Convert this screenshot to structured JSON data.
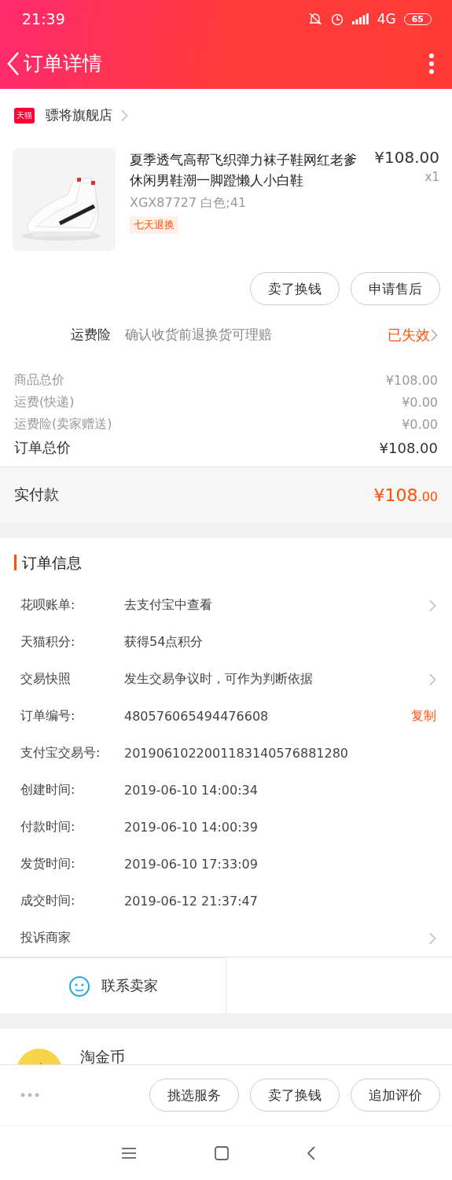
{
  "status_bar": {
    "time": "21:39",
    "network": "4G",
    "battery": "65"
  },
  "nav": {
    "title": "订单详情"
  },
  "shop": {
    "badge": "天猫",
    "name": "骠将旗舰店"
  },
  "product": {
    "title": "夏季透气高帮飞织弹力袜子鞋网红老爹休闲男鞋潮一脚蹬懒人小白鞋",
    "price": "¥108.00",
    "quantity": "x1",
    "sku": "XGX87727 白色;41",
    "tag": "七天退换"
  },
  "product_actions": [
    "卖了换钱",
    "申请售后"
  ],
  "insurance": {
    "label": "运费险",
    "description": "确认收货前退换货可理赔",
    "status": "已失效"
  },
  "price_lines": [
    {
      "label": "商品总价",
      "value": "¥108.00",
      "kind": "minor"
    },
    {
      "label": "运费(快递)",
      "value": "¥0.00",
      "kind": "minor"
    },
    {
      "label": "运费险(卖家赠送)",
      "value": "¥0.00",
      "kind": "minor"
    },
    {
      "label": "订单总价",
      "value": "¥108.00",
      "kind": "total"
    }
  ],
  "paid": {
    "label": "实付款",
    "amount": "¥108",
    "cents": ".00"
  },
  "order_info": {
    "title": "订单信息",
    "rows": [
      {
        "label": "花呗账单:",
        "value": "去支付宝中查看",
        "chevron": true
      },
      {
        "label": "天猫积分:",
        "value": "获得54点积分",
        "chevron": false
      },
      {
        "label": "交易快照",
        "value": "发生交易争议时，可作为判断依据",
        "chevron": true
      },
      {
        "label": "订单编号:",
        "value": "480576065494476608",
        "action": "复制",
        "chevron": false
      },
      {
        "label": "支付宝交易号:",
        "value": "2019061022001183140576881280",
        "chevron": false
      },
      {
        "label": "创建时间:",
        "value": "2019-06-10 14:00:34",
        "chevron": false
      },
      {
        "label": "付款时间:",
        "value": "2019-06-10 14:00:39",
        "chevron": false
      },
      {
        "label": "发货时间:",
        "value": "2019-06-10 17:33:09",
        "chevron": false
      },
      {
        "label": "成交时间:",
        "value": "2019-06-12 21:37:47",
        "chevron": false
      },
      {
        "label": "投诉商家",
        "chevron": true
      }
    ]
  },
  "contact": {
    "label": "联系卖家"
  },
  "coin": {
    "title": "淘金币"
  },
  "bottom_bar": {
    "buttons": [
      "挑选服务",
      "卖了换钱",
      "追加评价"
    ]
  }
}
